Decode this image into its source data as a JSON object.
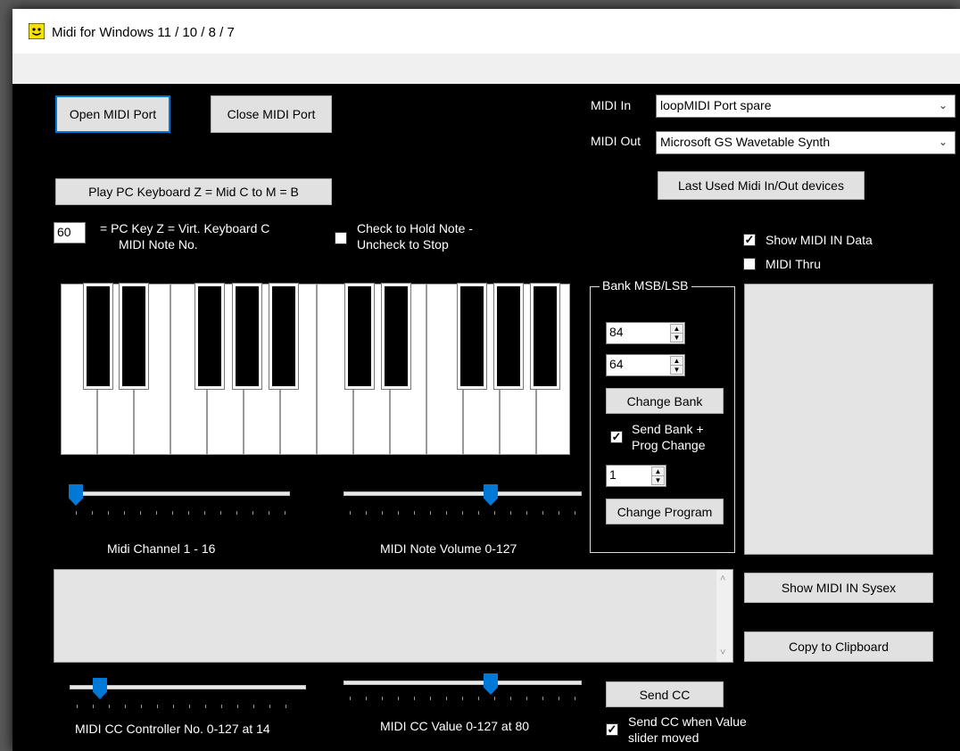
{
  "window": {
    "title": "Midi for Windows 11 / 10 / 8 / 7"
  },
  "buttons": {
    "open_port": "Open MIDI Port",
    "close_port": "Close MIDI Port",
    "play_pc_keyboard": "Play PC Keyboard Z = Mid C to M = B",
    "last_used_devices": "Last Used Midi In/Out devices",
    "change_bank": "Change Bank",
    "change_program": "Change Program",
    "show_sysex": "Show MIDI IN Sysex",
    "copy_clipboard": "Copy to Clipboard",
    "send_cc": "Send CC"
  },
  "midi_in": {
    "label": "MIDI In",
    "value": "loopMIDI Port spare"
  },
  "midi_out": {
    "label": "MIDI Out",
    "value": "Microsoft GS Wavetable Synth"
  },
  "note_number": {
    "value": "60",
    "line1": "=   PC Key Z = Virt. Keyboard C",
    "line2": "MIDI Note No."
  },
  "hold_note": {
    "line1": "Check to Hold Note -",
    "line2": "Uncheck to Stop",
    "checked": false
  },
  "show_midi_in_data": {
    "label": "Show MIDI IN Data",
    "checked": true
  },
  "midi_thru": {
    "label": "MIDI Thru",
    "checked": false
  },
  "bank_group": {
    "title": "Bank MSB/LSB",
    "msb": "84",
    "lsb": "64",
    "send_bank_line1": "Send Bank +",
    "send_bank_line2": "Prog Change",
    "send_bank_checked": true,
    "program": "1"
  },
  "sliders": {
    "channel": {
      "label": "Midi Channel 1 - 16",
      "fraction": 0.0
    },
    "note_volume": {
      "label": "MIDI Note Volume 0-127",
      "fraction": 0.63
    },
    "cc_controller": {
      "label": "MIDI CC Controller No. 0-127 at 14",
      "fraction": 0.11
    },
    "cc_value": {
      "label": "MIDI CC Value 0-127 at 80",
      "fraction": 0.63
    }
  },
  "send_cc_option": {
    "line1": "Send CC when Value",
    "line2": "slider moved",
    "checked": true
  },
  "icons": {
    "app": "smiley-icon",
    "dropdown": "chevron-down-icon",
    "check": "checkmark-icon",
    "scroll_up": "scroll-up-icon",
    "scroll_down": "scroll-down-icon"
  },
  "colors": {
    "accent": "#0078d7",
    "background": "#000000",
    "panel": "#e4e4e4"
  }
}
